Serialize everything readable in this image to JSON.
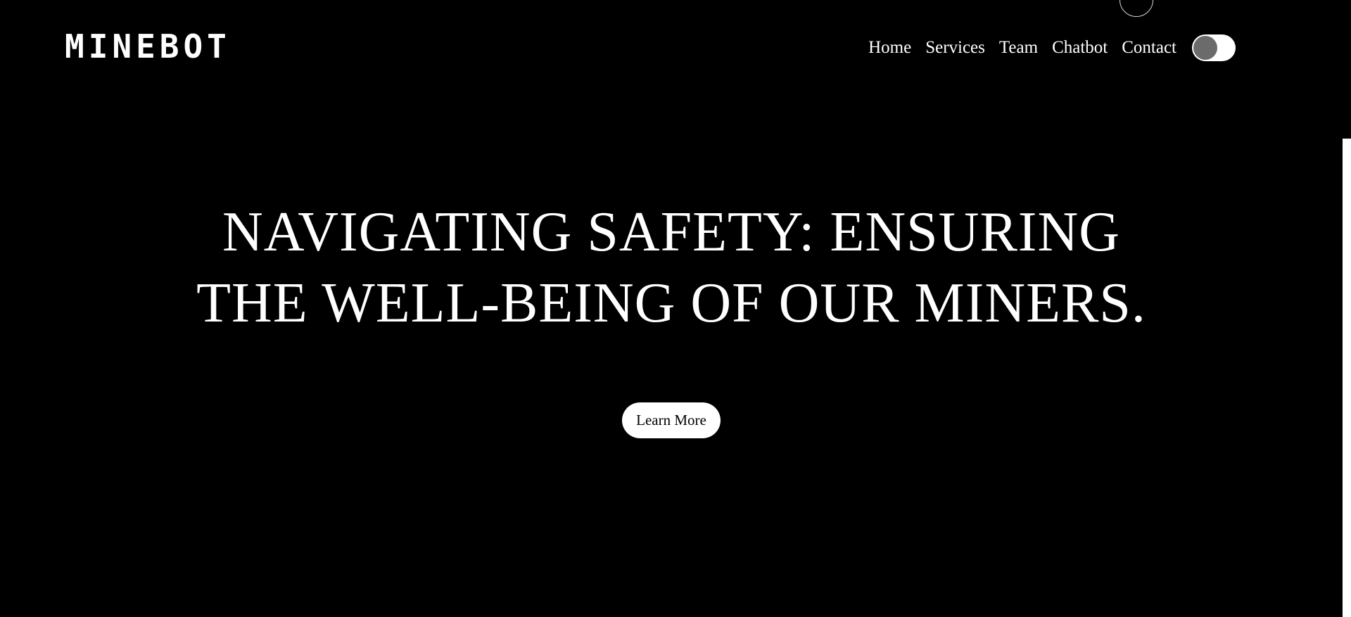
{
  "header": {
    "logo": "MINEBOT",
    "nav": [
      "Home",
      "Services",
      "Team",
      "Chatbot",
      "Contact"
    ]
  },
  "hero": {
    "title_line1": "NAVIGATING SAFETY: ENSURING",
    "title_line2": "THE WELL-BEING OF OUR MINERS.",
    "cta_label": "Learn More"
  },
  "colors": {
    "background": "#000000",
    "text": "#ffffff",
    "button_background": "#ffffff",
    "button_text": "#000000",
    "toggle_knob": "#6b6b6b"
  }
}
